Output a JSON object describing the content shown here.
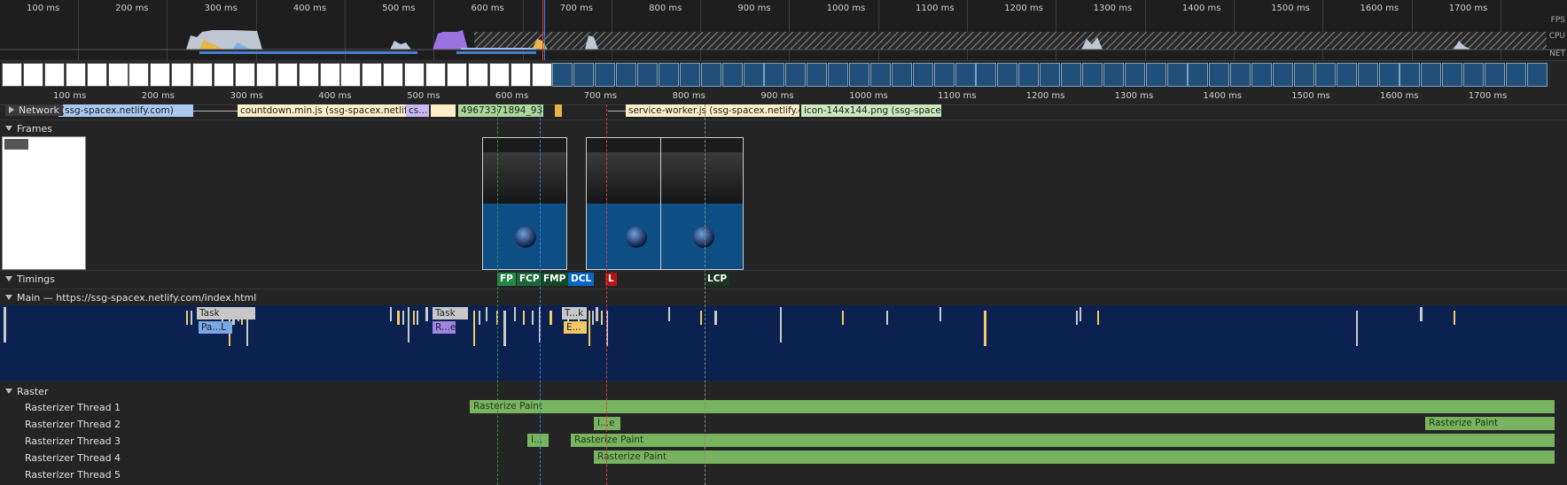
{
  "overview": {
    "ticks": [
      "100 ms",
      "200 ms",
      "300 ms",
      "400 ms",
      "500 ms",
      "600 ms",
      "700 ms",
      "800 ms",
      "900 ms",
      "1000 ms",
      "1100 ms",
      "1200 ms",
      "1300 ms",
      "1400 ms",
      "1500 ms",
      "1600 ms",
      "1700 ms"
    ],
    "labels": {
      "fps": "FPS",
      "cpu": "CPU",
      "net": "NET"
    }
  },
  "ruler": {
    "ticks": [
      "100 ms",
      "200 ms",
      "300 ms",
      "400 ms",
      "500 ms",
      "600 ms",
      "700 ms",
      "800 ms",
      "900 ms",
      "1000 ms",
      "1100 ms",
      "1200 ms",
      "1300 ms",
      "1400 ms",
      "1500 ms",
      "1600 ms",
      "1700 ms"
    ]
  },
  "network": {
    "label": "Network",
    "requests": [
      {
        "name": "(ssg-spacex.netlify.com)",
        "color": "#a8c8f0"
      },
      {
        "name": "countdown.min.js (ssg-spacex.netlify.c...",
        "color": "#fdeec8"
      },
      {
        "name": "cs...",
        "color": "#c9b8f3"
      },
      {
        "name": "49673371894_93...",
        "color": "#a9d89a"
      },
      {
        "name": "service-worker.js (ssg-spacex.netlify.c...",
        "color": "#fdeec8"
      },
      {
        "name": "icon-144x144.png (ssg-space...",
        "color": "#c9e8bd"
      }
    ]
  },
  "frames": {
    "label": "Frames"
  },
  "timings": {
    "label": "Timings",
    "markers": [
      {
        "name": "FP",
        "color": "#228847"
      },
      {
        "name": "FCP",
        "color": "#1a6937"
      },
      {
        "name": "FMP",
        "color": "#134a26"
      },
      {
        "name": "DCL",
        "color": "#0867cb"
      },
      {
        "name": "L",
        "color": "#b31412"
      },
      {
        "name": "LCP",
        "color": "#1a3422"
      }
    ]
  },
  "main": {
    "label": "Main — https://ssg-spacex.netlify.com/index.html",
    "tasks": [
      {
        "name": "Task"
      },
      {
        "name": "Pa...L"
      },
      {
        "name": "Task"
      },
      {
        "name": "R...e"
      },
      {
        "name": "T...k"
      },
      {
        "name": "E..."
      }
    ]
  },
  "raster": {
    "label": "Raster",
    "threads": [
      {
        "name": "Rasterizer Thread 1",
        "bars": [
          "Rasterize Paint"
        ]
      },
      {
        "name": "Rasterizer Thread 2",
        "bars": [
          "I...e",
          "Rasterize Paint"
        ]
      },
      {
        "name": "Rasterizer Thread 3",
        "bars": [
          "I...",
          "Rasterize Paint"
        ]
      },
      {
        "name": "Rasterizer Thread 4",
        "bars": [
          "Rasterize Paint"
        ]
      },
      {
        "name": "Rasterizer Thread 5",
        "bars": []
      }
    ]
  }
}
